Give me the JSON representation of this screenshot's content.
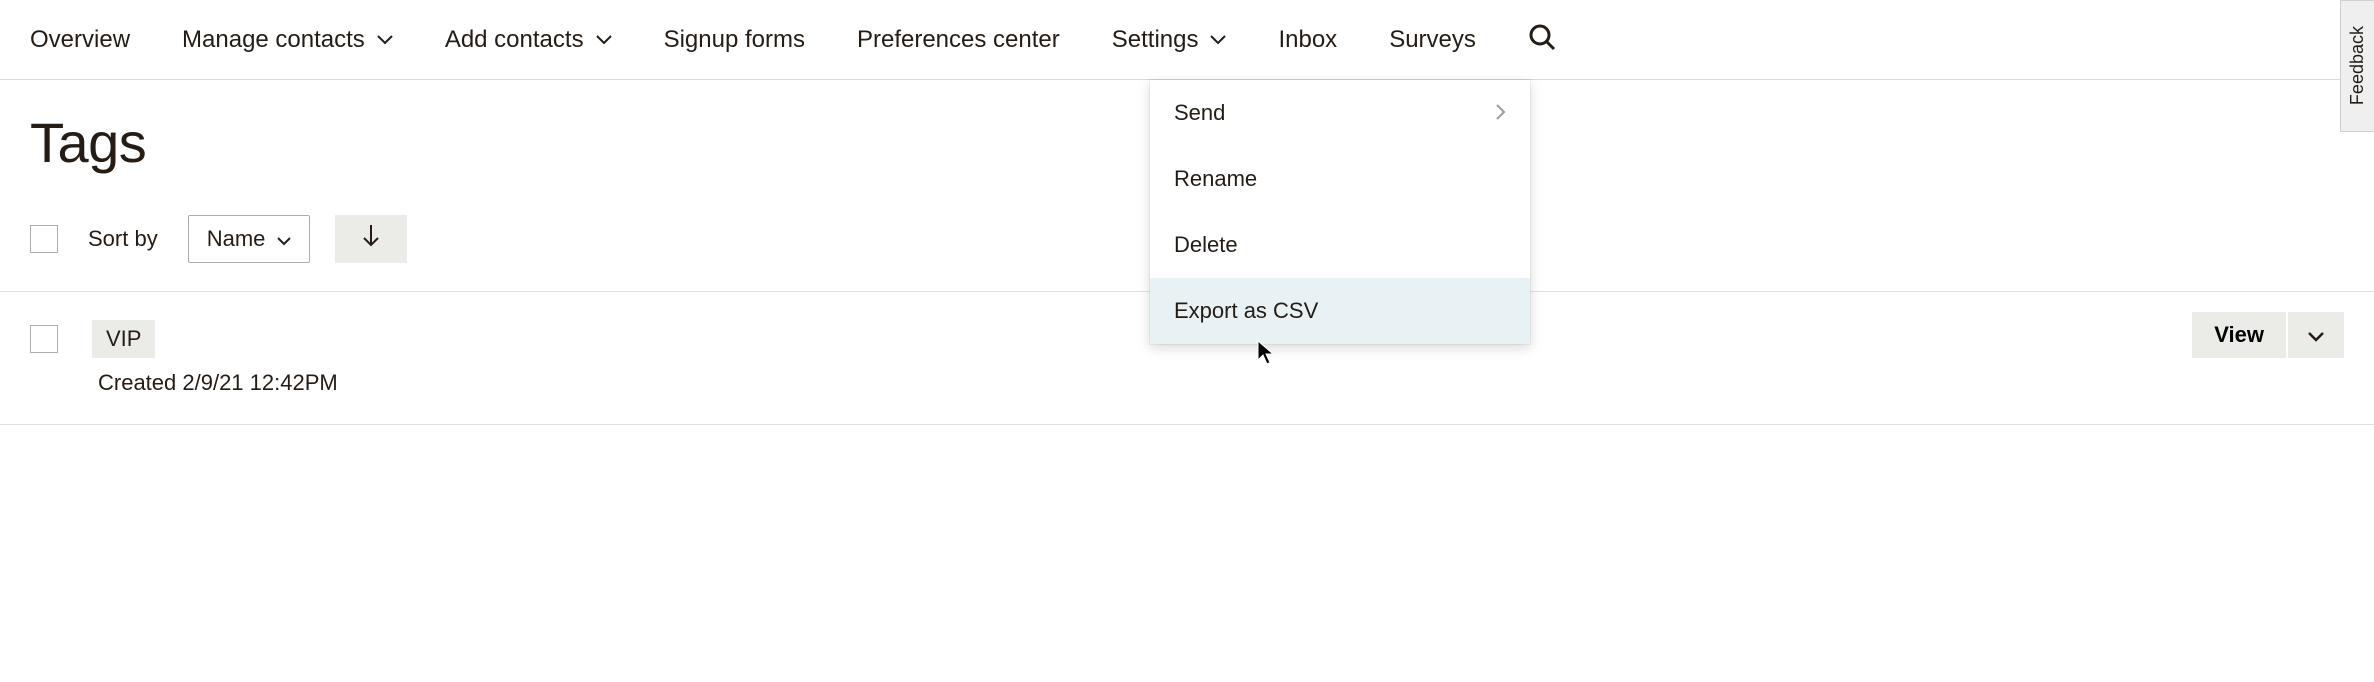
{
  "nav": {
    "overview": "Overview",
    "manage_contacts": "Manage contacts",
    "add_contacts": "Add contacts",
    "signup_forms": "Signup forms",
    "preferences_center": "Preferences center",
    "settings": "Settings",
    "inbox": "Inbox",
    "surveys": "Surveys"
  },
  "page": {
    "title": "Tags"
  },
  "toolbar": {
    "sort_by_label": "Sort by",
    "sort_field": "Name"
  },
  "tags": [
    {
      "name": "VIP",
      "created_label": "Created 2/9/21 12:42PM"
    }
  ],
  "row_actions": {
    "view": "View"
  },
  "dropdown": {
    "send": "Send",
    "rename": "Rename",
    "delete": "Delete",
    "export_csv": "Export as CSV"
  },
  "feedback": {
    "label": "Feedback"
  }
}
